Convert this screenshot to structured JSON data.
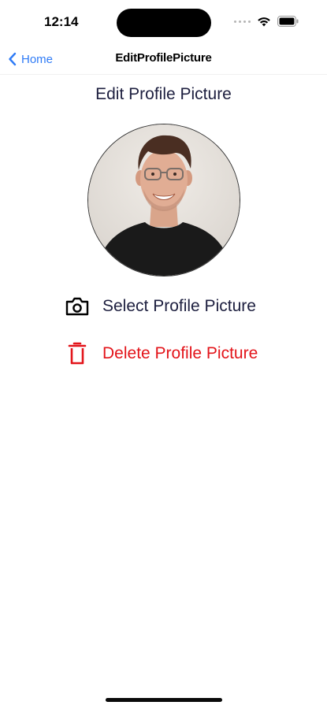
{
  "status_bar": {
    "time": "12:14",
    "wifi_icon": "wifi-icon",
    "battery_icon": "battery-icon"
  },
  "nav": {
    "back_label": "Home",
    "title": "EditProfilePicture",
    "accent_color": "#2f7bf6"
  },
  "page": {
    "title": "Edit Profile Picture"
  },
  "avatar": {
    "description_icon": "profile-photo"
  },
  "actions": {
    "select_label": "Select Profile Picture",
    "select_icon": "camera-icon",
    "delete_label": "Delete Profile Picture",
    "delete_icon": "trash-icon",
    "delete_color": "#e3141a"
  }
}
